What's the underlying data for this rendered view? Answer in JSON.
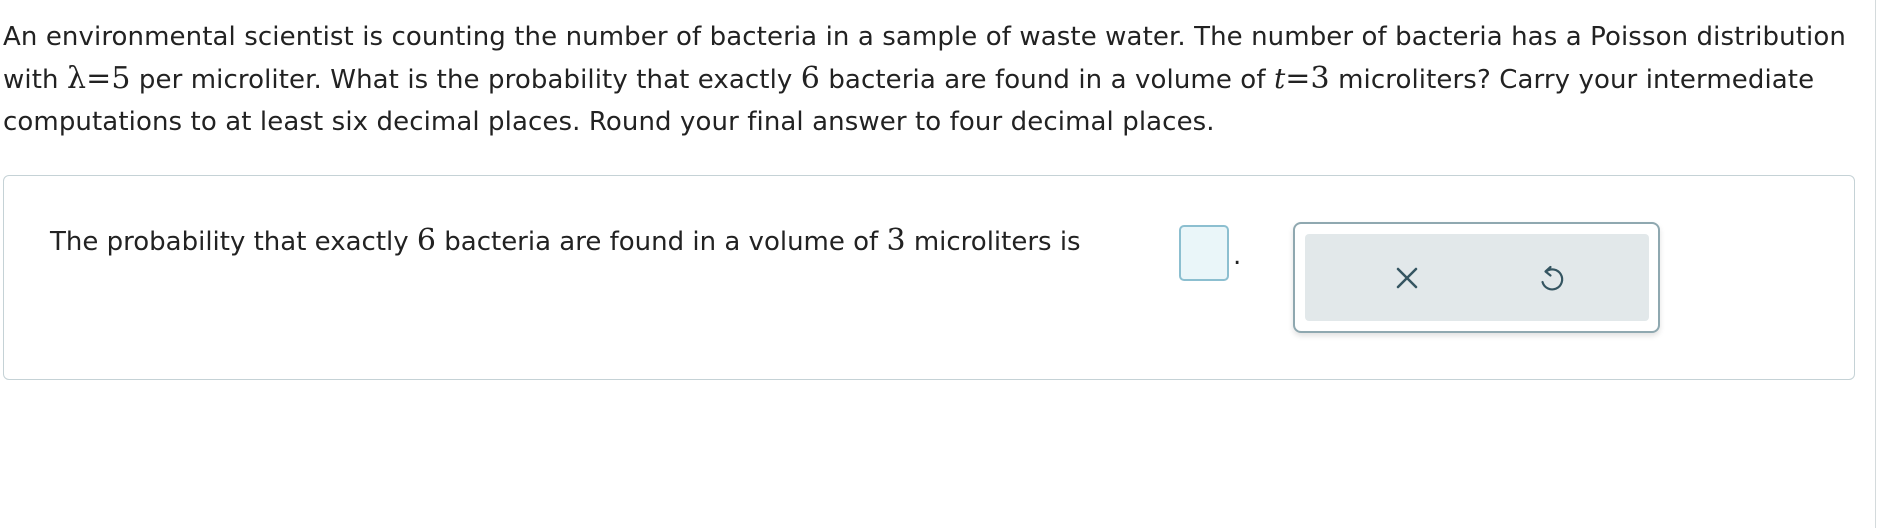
{
  "question": {
    "text_1": "An environmental scientist is counting the number of bacteria in a sample of waste water. The number of bacteria has a Poisson distribution with ",
    "lambda_symbol": "λ",
    "equals_1": "=",
    "lambda_value": "5",
    "text_2": " per microliter. What is the probability that exactly ",
    "count_value": "6",
    "text_3": " bacteria are found in a volume of ",
    "t_symbol": "t",
    "equals_2": "=",
    "t_value": "3",
    "text_4": " microliters? Carry your intermediate computations to at least six decimal places. Round your final answer to four decimal places."
  },
  "answer": {
    "text_1": "The probability that exactly ",
    "count_value": "6",
    "text_2": " bacteria are found in a volume of ",
    "volume_value": "3",
    "text_3": " microliters is",
    "input_value": "",
    "period": "."
  },
  "tools": {
    "clear_icon": "close-icon",
    "undo_icon": "undo-icon"
  },
  "colors": {
    "input_border": "#8cbfd0",
    "input_fill": "#eaf6f9",
    "tool_background": "#e2e8ea",
    "icon": "#355561"
  }
}
